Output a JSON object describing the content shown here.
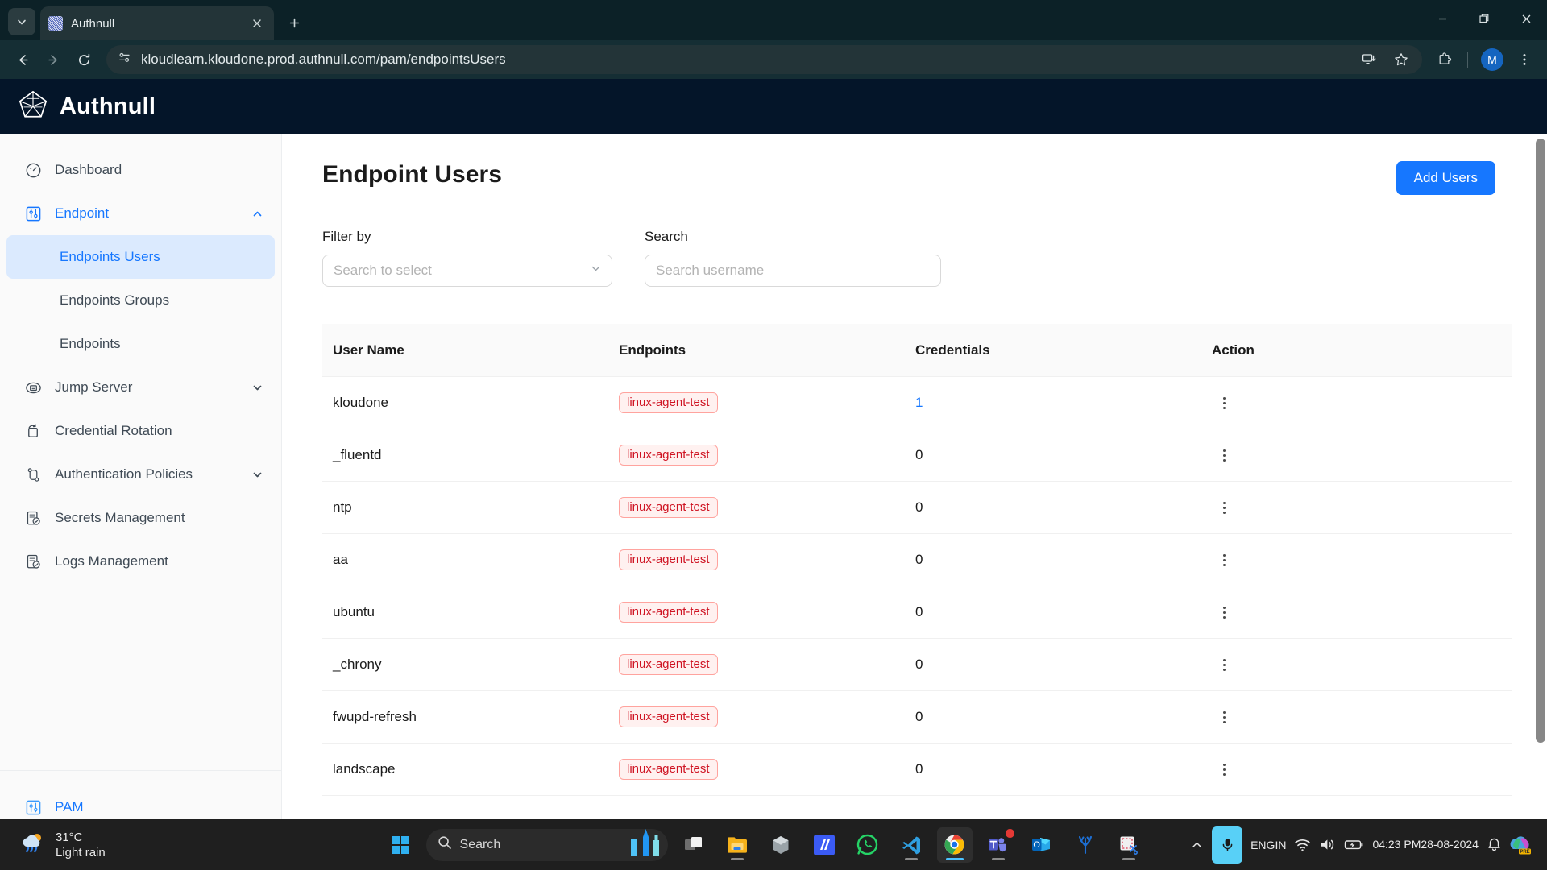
{
  "browser": {
    "tab": {
      "title": "Authnull",
      "favicon_icon": "site-favicon",
      "close_icon": "close-icon"
    },
    "tab_search_icon": "chevron-down-icon",
    "new_tab_icon": "plus-icon",
    "window_controls": {
      "minimize": "minimize-icon",
      "maximize": "restore-icon",
      "close": "close-icon"
    },
    "toolbar": {
      "back_icon": "arrow-left-icon",
      "forward_icon": "arrow-right-icon",
      "reload_icon": "reload-icon",
      "site_info_icon": "site-settings-icon",
      "url": "kloudlearn.kloudone.prod.authnull.com/pam/endpointsUsers",
      "url_placeholder": "Search Google or type a URL",
      "install_icon": "install-app-icon",
      "bookmark_icon": "star-icon",
      "extensions_icon": "extensions-puzzle-icon",
      "profile_initial": "M",
      "menu_icon": "three-dot-menu-icon"
    }
  },
  "app": {
    "brand": "Authnull",
    "brand_logo_icon": "authnull-pentagon-logo",
    "accent_color": "#1677ff",
    "header_bg": "#041529"
  },
  "sidebar": {
    "items": [
      {
        "label": "Dashboard",
        "icon": "dashboard-gauge-icon",
        "caret": null,
        "state": "normal"
      },
      {
        "label": "Endpoint",
        "icon": "sliders-icon",
        "caret": "chevron-up-icon",
        "state": "expanded"
      },
      {
        "label": "Jump Server",
        "icon": "server-icon",
        "caret": "chevron-down-icon",
        "state": "normal"
      },
      {
        "label": "Credential Rotation",
        "icon": "rotate-icon",
        "caret": null,
        "state": "normal"
      },
      {
        "label": "Authentication Policies",
        "icon": "branch-icon",
        "caret": "chevron-down-icon",
        "state": "normal"
      },
      {
        "label": "Secrets Management",
        "icon": "shield-doc-icon",
        "caret": null,
        "state": "normal"
      },
      {
        "label": "Logs Management",
        "icon": "shield-doc-icon",
        "caret": null,
        "state": "normal"
      }
    ],
    "endpoint_children": [
      {
        "label": "Endpoints Users",
        "selected": true
      },
      {
        "label": "Endpoints Groups",
        "selected": false
      },
      {
        "label": "Endpoints",
        "selected": false
      }
    ],
    "bottom": {
      "label": "PAM",
      "icon": "sliders-icon"
    }
  },
  "main": {
    "page_title": "Endpoint Users",
    "add_users_label": "Add Users",
    "filter": {
      "label": "Filter by",
      "placeholder": "Search to select",
      "value": "",
      "caret_icon": "chevron-down-icon"
    },
    "search": {
      "label": "Search",
      "placeholder": "Search username",
      "value": ""
    },
    "table": {
      "columns": [
        "User Name",
        "Endpoints",
        "Credentials",
        "Action"
      ],
      "action_icon": "kebab-menu-icon",
      "rows": [
        {
          "user": "kloudone",
          "endpoint": "linux-agent-test",
          "credentials": "1",
          "credentials_link": true
        },
        {
          "user": "_fluentd",
          "endpoint": "linux-agent-test",
          "credentials": "0",
          "credentials_link": false
        },
        {
          "user": "ntp",
          "endpoint": "linux-agent-test",
          "credentials": "0",
          "credentials_link": false
        },
        {
          "user": "aa",
          "endpoint": "linux-agent-test",
          "credentials": "0",
          "credentials_link": false
        },
        {
          "user": "ubuntu",
          "endpoint": "linux-agent-test",
          "credentials": "0",
          "credentials_link": false
        },
        {
          "user": "_chrony",
          "endpoint": "linux-agent-test",
          "credentials": "0",
          "credentials_link": false
        },
        {
          "user": "fwupd-refresh",
          "endpoint": "linux-agent-test",
          "credentials": "0",
          "credentials_link": false
        },
        {
          "user": "landscape",
          "endpoint": "linux-agent-test",
          "credentials": "0",
          "credentials_link": false
        }
      ],
      "tag_colors": {
        "bg": "#fff1f0",
        "border": "#ffa39e",
        "text": "#cf1322"
      }
    }
  },
  "taskbar": {
    "weather": {
      "temperature": "31°C",
      "condition": "Light rain",
      "icon": "sun-cloud-rain-icon"
    },
    "start_icon": "windows-start-icon",
    "search": {
      "placeholder": "Search",
      "icon": "search-icon",
      "decoration_icon": "skyline-icon"
    },
    "apps": [
      {
        "name": "task-view-icon",
        "active": false,
        "running": false
      },
      {
        "name": "file-explorer-icon",
        "active": false,
        "running": true
      },
      {
        "name": "copilot-icon",
        "active": false,
        "running": false
      },
      {
        "name": "authnull-app-icon",
        "active": false,
        "running": false
      },
      {
        "name": "whatsapp-icon",
        "active": false,
        "running": false
      },
      {
        "name": "vscode-icon",
        "active": false,
        "running": true
      },
      {
        "name": "chrome-icon",
        "active": true,
        "running": true
      },
      {
        "name": "teams-icon",
        "active": false,
        "running": true,
        "badge": true
      },
      {
        "name": "outlook-icon",
        "active": false,
        "running": false
      },
      {
        "name": "coral-icon",
        "active": false,
        "running": false
      },
      {
        "name": "snipping-tool-icon",
        "active": false,
        "running": true
      }
    ],
    "tray": {
      "overflow_icon": "chevron-up-icon",
      "mic_icon": "microphone-icon",
      "language": "ENG",
      "region": "IN",
      "wifi_icon": "wifi-icon",
      "volume_icon": "speaker-icon",
      "battery_icon": "battery-charging-icon",
      "time": "04:23 PM",
      "date": "28-08-2024",
      "notification_icon": "bell-icon",
      "copilot_icon": "copilot-pre-icon"
    }
  }
}
